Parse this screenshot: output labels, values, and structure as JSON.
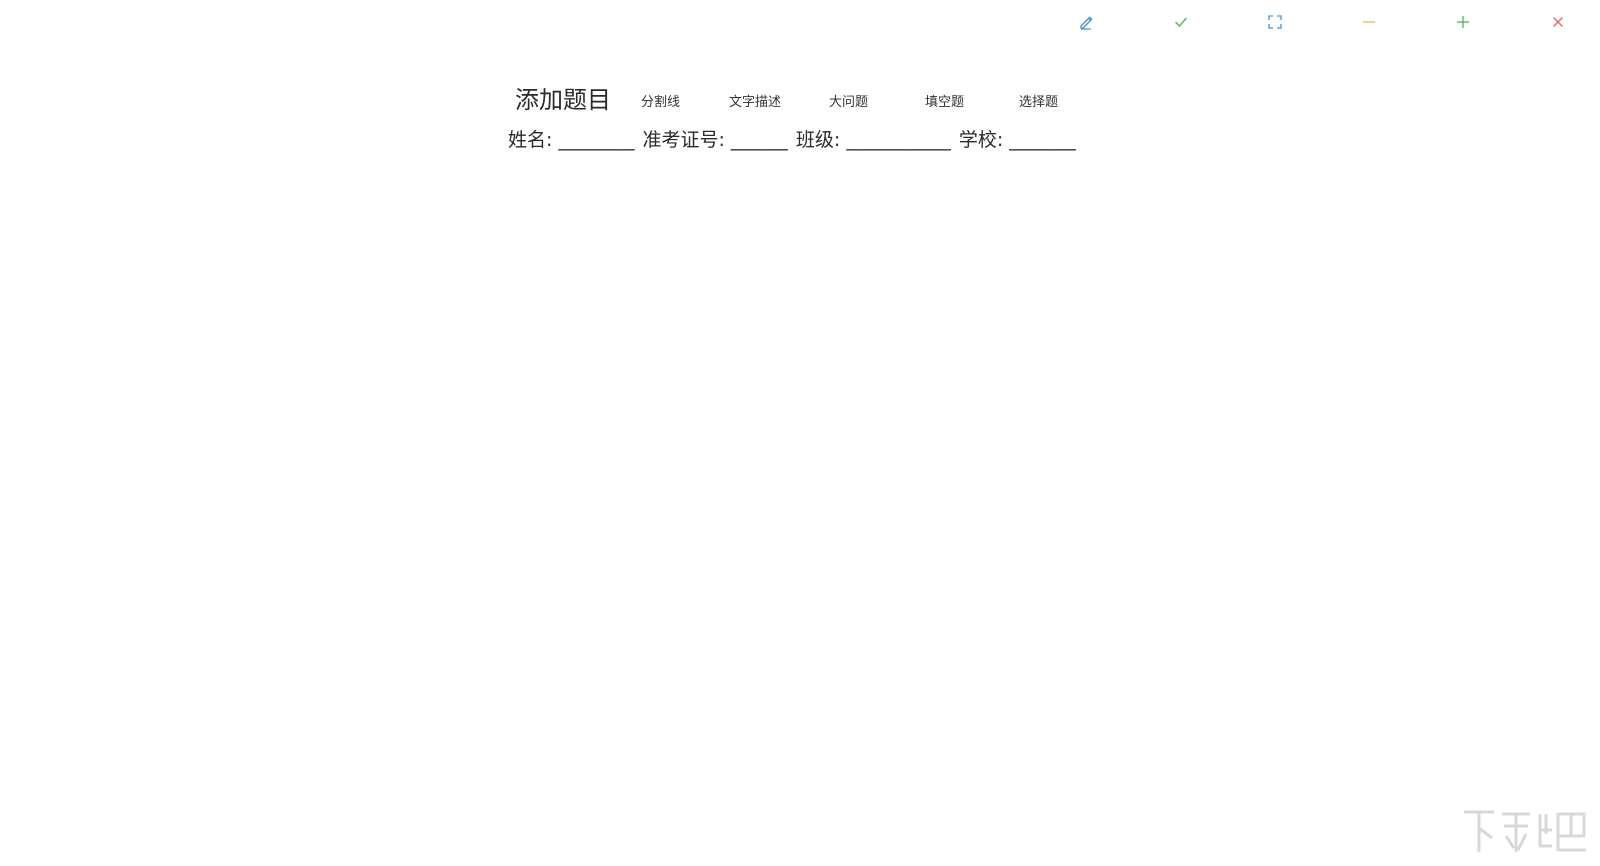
{
  "toolbar": {
    "buttons": [
      {
        "name": "edit",
        "icon": "pencil-icon",
        "color": "#4a90c9"
      },
      {
        "name": "confirm",
        "icon": "check-icon",
        "color": "#5cb85c"
      },
      {
        "name": "fullscreen",
        "icon": "fullscreen-icon",
        "color": "#4a90c9"
      },
      {
        "name": "minimize",
        "icon": "minus-icon",
        "color": "#e8c45a"
      },
      {
        "name": "add",
        "icon": "plus-icon",
        "color": "#5cb85c"
      },
      {
        "name": "close",
        "icon": "close-icon",
        "color": "#e06a6a"
      }
    ]
  },
  "question_bar": {
    "title": "添加题目",
    "items": [
      "分割线",
      "文字描述",
      "大问题",
      "填空题",
      "选择题"
    ]
  },
  "info_line": {
    "fields": [
      "姓名: ________",
      "准考证号: ______",
      "班级: ___________",
      "学校: _______"
    ]
  }
}
